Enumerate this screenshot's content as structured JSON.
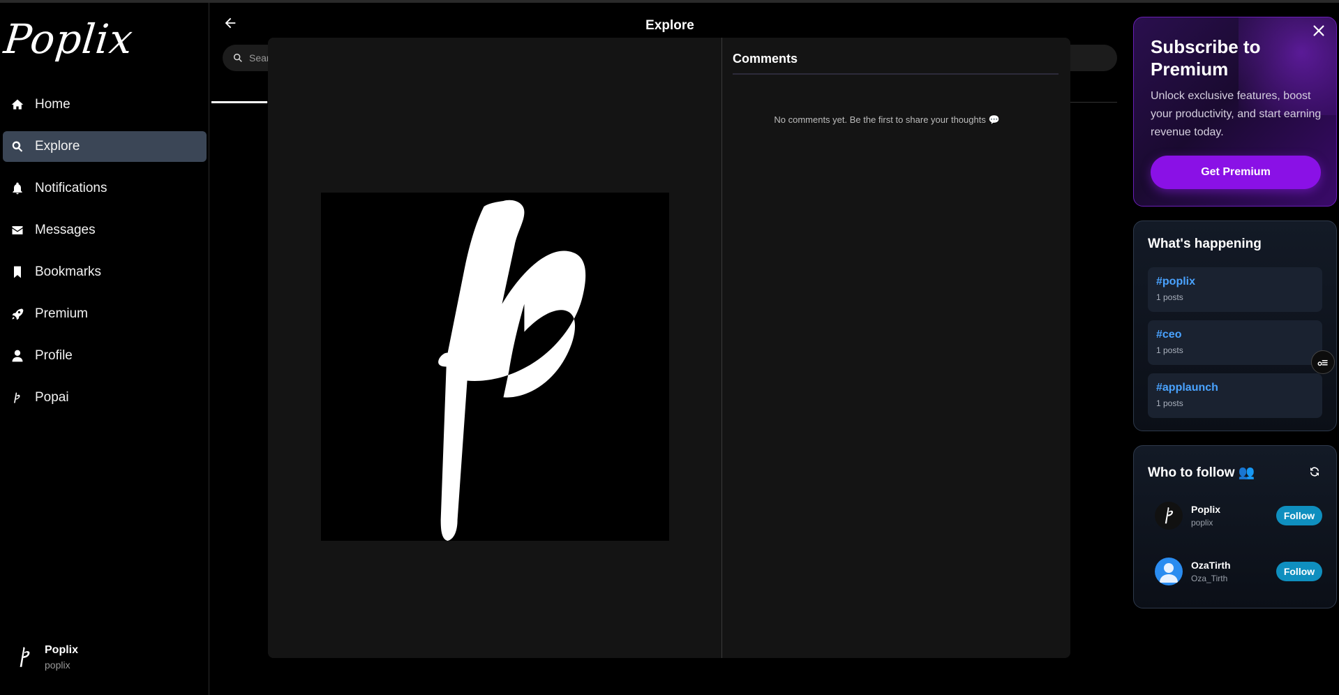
{
  "app": {
    "logo_text": "Poplix"
  },
  "sidebar": {
    "items": [
      {
        "label": "Home",
        "icon": "home-icon",
        "active": false
      },
      {
        "label": "Explore",
        "icon": "search-icon",
        "active": true
      },
      {
        "label": "Notifications",
        "icon": "bell-icon",
        "active": false
      },
      {
        "label": "Messages",
        "icon": "envelope-icon",
        "active": false
      },
      {
        "label": "Bookmarks",
        "icon": "bookmark-icon",
        "active": false
      },
      {
        "label": "Premium",
        "icon": "rocket-icon",
        "active": false
      },
      {
        "label": "Profile",
        "icon": "user-icon",
        "active": false
      },
      {
        "label": "Popai",
        "icon": "popai-logo-icon",
        "active": false
      }
    ],
    "user": {
      "name": "Poplix",
      "handle": "poplix"
    }
  },
  "main": {
    "title": "Explore",
    "search": {
      "placeholder": "Search"
    }
  },
  "modal": {
    "comments_title": "Comments",
    "empty_message": "No comments yet. Be the first to share your thoughts 💬"
  },
  "premium": {
    "title": "Subscribe to Premium",
    "description": "Unlock exclusive features, boost your productivity, and start earning revenue today.",
    "button": "Get Premium"
  },
  "trending": {
    "title": "What's happening",
    "items": [
      {
        "tag": "#poplix",
        "count": "1 posts"
      },
      {
        "tag": "#ceo",
        "count": "1 posts"
      },
      {
        "tag": "#applaunch",
        "count": "1 posts"
      }
    ]
  },
  "who_to_follow": {
    "title": "Who to follow 👥",
    "users": [
      {
        "name": "Poplix",
        "handle": "poplix",
        "button": "Follow"
      },
      {
        "name": "OzaTirth",
        "handle": "Oza_Tirth",
        "button": "Follow"
      }
    ]
  },
  "colors": {
    "accent_purple": "#8a11e6",
    "link_blue": "#4aa3ff",
    "follow_blue": "#0f8fbf",
    "active_nav": "#3b4656"
  }
}
